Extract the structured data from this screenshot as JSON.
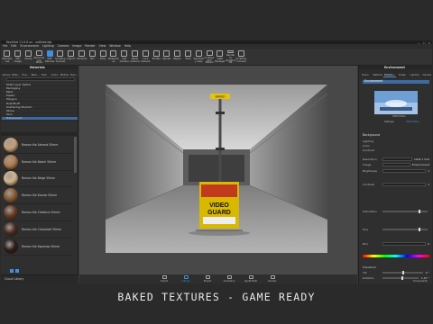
{
  "window": {
    "title": "KeyShot 11.0.0.xx - untitled.bip",
    "controls": [
      "—",
      "☐",
      "✕"
    ]
  },
  "menu": [
    "File",
    "Edit",
    "Environment",
    "Lighting",
    "Camera",
    "Image",
    "Render",
    "View",
    "Window",
    "Help"
  ],
  "toolbar": [
    {
      "label": "Workspaces",
      "icon": "layout-icon"
    },
    {
      "label": "CPU Usage",
      "icon": "cpu-icon"
    },
    {
      "label": "Pause",
      "icon": "pause-icon"
    },
    {
      "label": "Performance Mode",
      "icon": "performance-icon"
    },
    {
      "label": "GPU Denoise",
      "icon": "denoise-icon",
      "active": true
    },
    {
      "label": "Scripting Console",
      "icon": "script-icon"
    },
    {
      "label": "Import",
      "icon": "import-icon"
    },
    {
      "label": "Cameras",
      "icon": "camera-icon"
    },
    {
      "label": "Pan",
      "icon": "pan-icon"
    },
    {
      "label": "Dolly",
      "icon": "dolly-icon"
    },
    {
      "label": "Perspective",
      "icon": "perspective-icon"
    },
    {
      "label": "Add Camera",
      "icon": "add-camera-icon"
    },
    {
      "label": "Reset Camera",
      "icon": "reset-camera-icon"
    },
    {
      "label": "Lock Camera",
      "icon": "lock-camera-icon"
    },
    {
      "label": "Tumble",
      "icon": "tumble-icon"
    },
    {
      "label": "Render",
      "icon": "render-icon"
    },
    {
      "label": "Region",
      "icon": "region-icon"
    },
    {
      "label": "Tools",
      "icon": "tools-icon"
    },
    {
      "label": "Geometry View",
      "icon": "geometry-icon"
    },
    {
      "label": "Configurator Wizard",
      "icon": "wizard-icon"
    },
    {
      "label": "Light Manager",
      "icon": "light-icon"
    },
    {
      "label": "Render to KeyShotXR",
      "icon": "xr-icon"
    },
    {
      "label": "Scripting Console",
      "icon": "console-icon"
    }
  ],
  "left_panel": {
    "title": "Materials",
    "tabs": [
      "Library",
      "Mate...",
      "Envi...",
      "Back...",
      "Text...",
      "Colors",
      "Models",
      "Favo..."
    ],
    "tree": [
      "Multi Layer Optics",
      "Packaging",
      "Paint",
      "Plastic",
      "Polygon",
      "Rust/Stuff",
      "Scattering Medium",
      "Stone",
      "Toon",
      "Translucent"
    ],
    "tree_selected": 9,
    "materials": [
      {
        "name": "Roman tile Almond 50mm",
        "color": "#c9a074"
      },
      {
        "name": "Roman tile Beech 50mm",
        "color": "#b57b4a"
      },
      {
        "name": "Roman tile Beige 50mm",
        "color": "#d4b58a"
      },
      {
        "name": "Roman tile Bronze 50mm",
        "color": "#8a5a30"
      },
      {
        "name": "Roman tile Chestnut 50mm",
        "color": "#6a3a22"
      },
      {
        "name": "Roman tile Chocolate 50mm",
        "color": "#4a2a1c"
      },
      {
        "name": "Roman tile Espresso 50mm",
        "color": "#2e1d16"
      }
    ],
    "footer": "Cloud Library"
  },
  "viewport": {
    "sign_top": "BAKED",
    "sign_line1": "VIDEO",
    "sign_line2": "GUARD"
  },
  "right_panel": {
    "title": "Environment",
    "tabs": [
      "Scene",
      "Material",
      "Environ...",
      "Image",
      "Lighting",
      "Camera"
    ],
    "env_name": "Environment",
    "thumb_caption": "HDRI Editor",
    "settings_label": "Settings",
    "background_label": "Background",
    "bg_options": [
      "Lighting",
      "Color",
      "Gradient"
    ],
    "rows": [
      {
        "label": "Resolution",
        "value": "1024 x 512"
      },
      {
        "label": "Image",
        "value": "Environment"
      },
      {
        "label": "Brightness",
        "value": "1"
      },
      {
        "label": "Contrast",
        "value": "1"
      },
      {
        "label": "Saturation",
        "value": ""
      },
      {
        "label": "Hue",
        "value": ""
      },
      {
        "label": "Blur",
        "value": "0"
      }
    ],
    "transform": {
      "title": "Transform",
      "tilt_label": "Tilt",
      "tilt_value": "0 °",
      "rotation_label": "Rotation",
      "rotation_value": "1.07 °"
    }
  },
  "bottom_bar": [
    {
      "label": "Import",
      "icon": "import-icon"
    },
    {
      "label": "Library",
      "icon": "library-icon",
      "active": true
    },
    {
      "label": "Project",
      "icon": "project-icon"
    },
    {
      "label": "Animation",
      "icon": "animation-icon"
    },
    {
      "label": "KeyShotXR",
      "icon": "xr-icon"
    },
    {
      "label": "Render",
      "icon": "render-icon"
    }
  ],
  "bottom_right": "Screenshot",
  "caption": "BAKED TEXTURES - GAME READY"
}
